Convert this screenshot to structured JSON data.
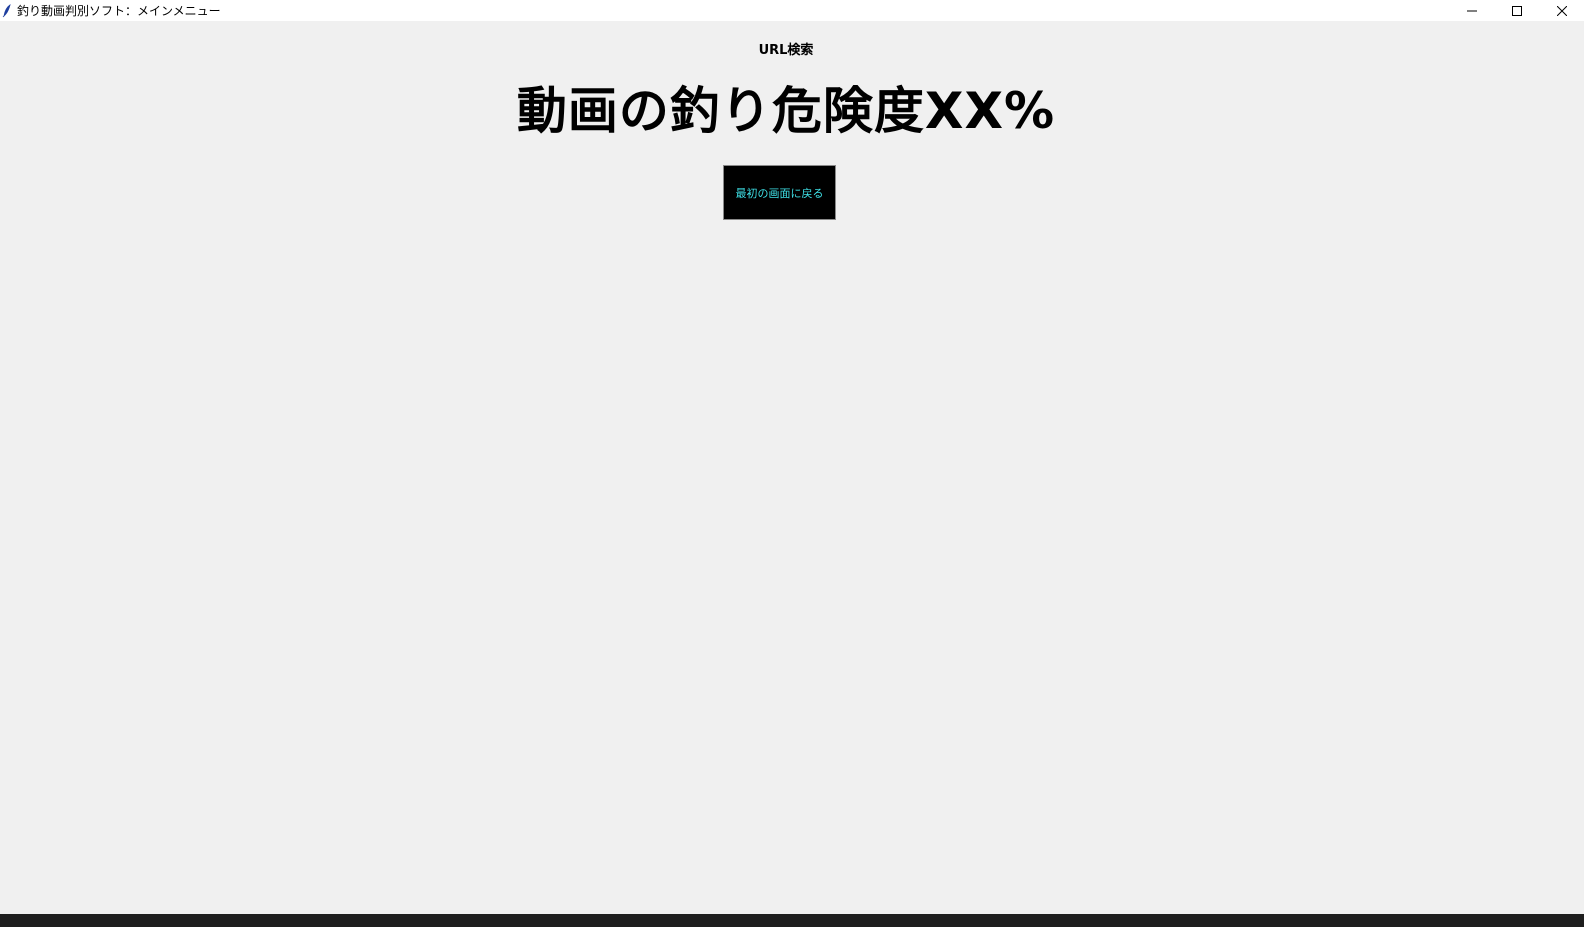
{
  "window": {
    "title": "釣り動画判別ソフト：メインメニュー",
    "controls": {
      "minimize": "minimize-icon",
      "maximize": "maximize-icon",
      "close": "close-icon"
    }
  },
  "main": {
    "url_label": "URL検索",
    "result_heading": "動画の釣り危険度XX%",
    "back_button_label": "最初の画面に戻る"
  },
  "colors": {
    "background": "#f0f0f0",
    "button_bg": "#000000",
    "button_text": "#3ee0e6"
  }
}
